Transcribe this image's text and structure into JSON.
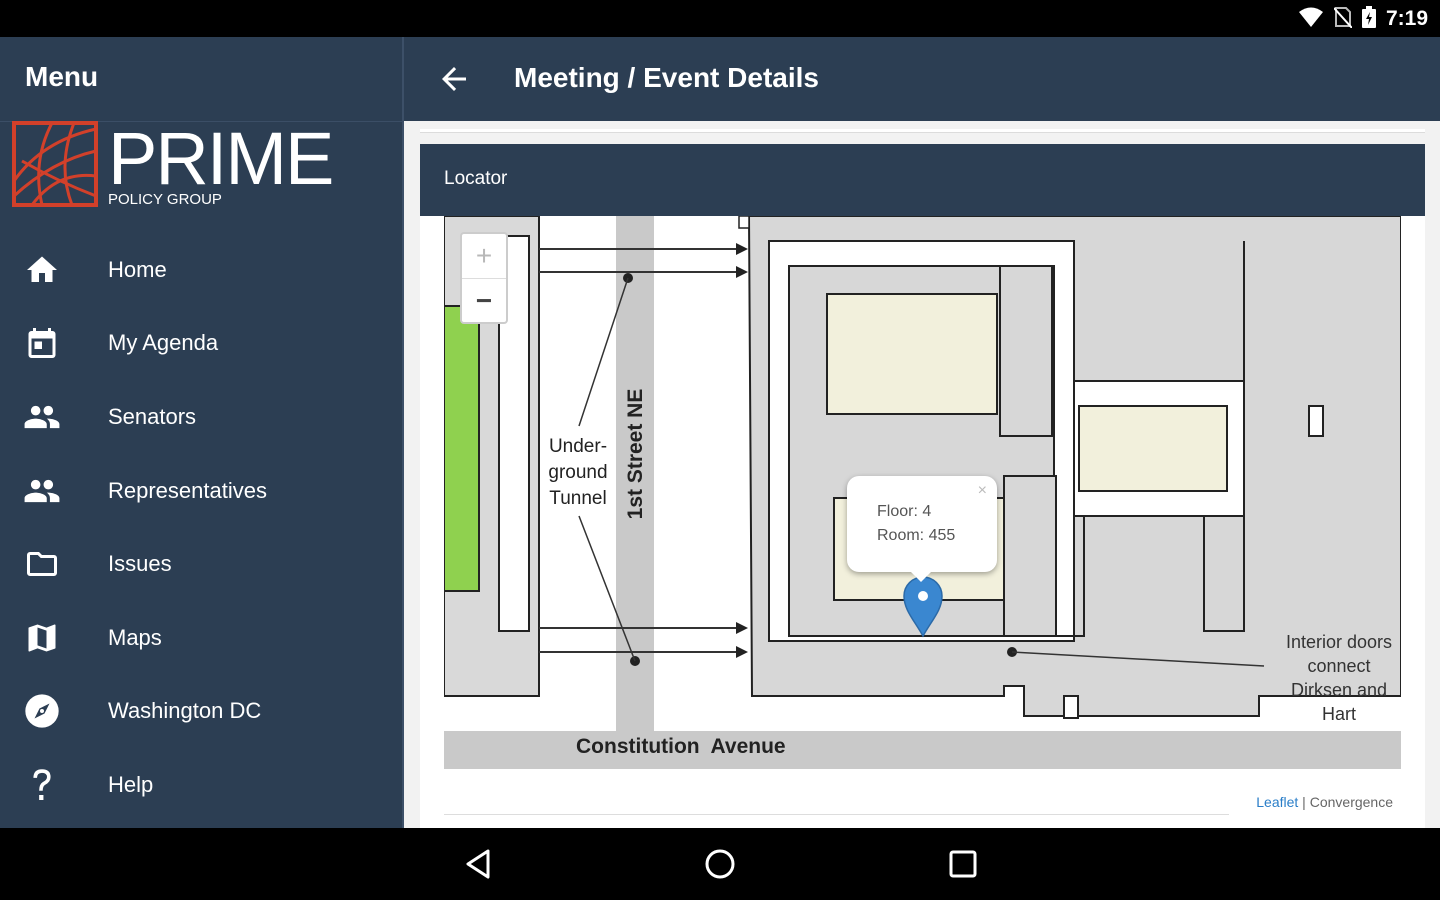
{
  "status_bar": {
    "time": "7:19",
    "icons": [
      "wifi-icon",
      "no-sim-icon",
      "battery-icon"
    ]
  },
  "drawer": {
    "title": "Menu",
    "logo": {
      "word": "PRIME",
      "subtitle": "POLICY GROUP",
      "accent_color": "#d2402a"
    },
    "items": [
      {
        "label": "Home",
        "icon": "home-icon"
      },
      {
        "label": "My Agenda",
        "icon": "calendar-icon"
      },
      {
        "label": "Senators",
        "icon": "people-icon"
      },
      {
        "label": "Representatives",
        "icon": "people-icon"
      },
      {
        "label": "Issues",
        "icon": "folder-icon"
      },
      {
        "label": "Maps",
        "icon": "map-icon"
      },
      {
        "label": "Washington DC",
        "icon": "compass-icon"
      },
      {
        "label": "Help",
        "icon": "help-icon"
      }
    ]
  },
  "appbar": {
    "title": "Meeting / Event Details",
    "back_icon": "arrow-back-icon"
  },
  "locator": {
    "header": "Locator",
    "zoom_in": "+",
    "zoom_out": "−",
    "popup": {
      "floor": "Floor: 4",
      "room": "Room: 455",
      "close": "×"
    },
    "labels": {
      "tunnel_line1": "Under-",
      "tunnel_line2": "ground",
      "tunnel_line3": "Tunnel",
      "street": "1st Street NE",
      "avenue": "Constitution  Avenue",
      "doors_line1": "Interior doors",
      "doors_line2": "connect",
      "doors_line3": "Dirksen and",
      "doors_line4": "Hart"
    },
    "attribution": {
      "leaflet": "Leaflet",
      "separator": " | ",
      "provider": "Convergence"
    },
    "colors": {
      "building": "#d7d7d7",
      "room": "#f2f0dc",
      "park": "#8fd14f",
      "marker": "#3a87d0"
    }
  },
  "theme": {
    "primary": "#2c3e53",
    "background": "#f2f2f2"
  }
}
